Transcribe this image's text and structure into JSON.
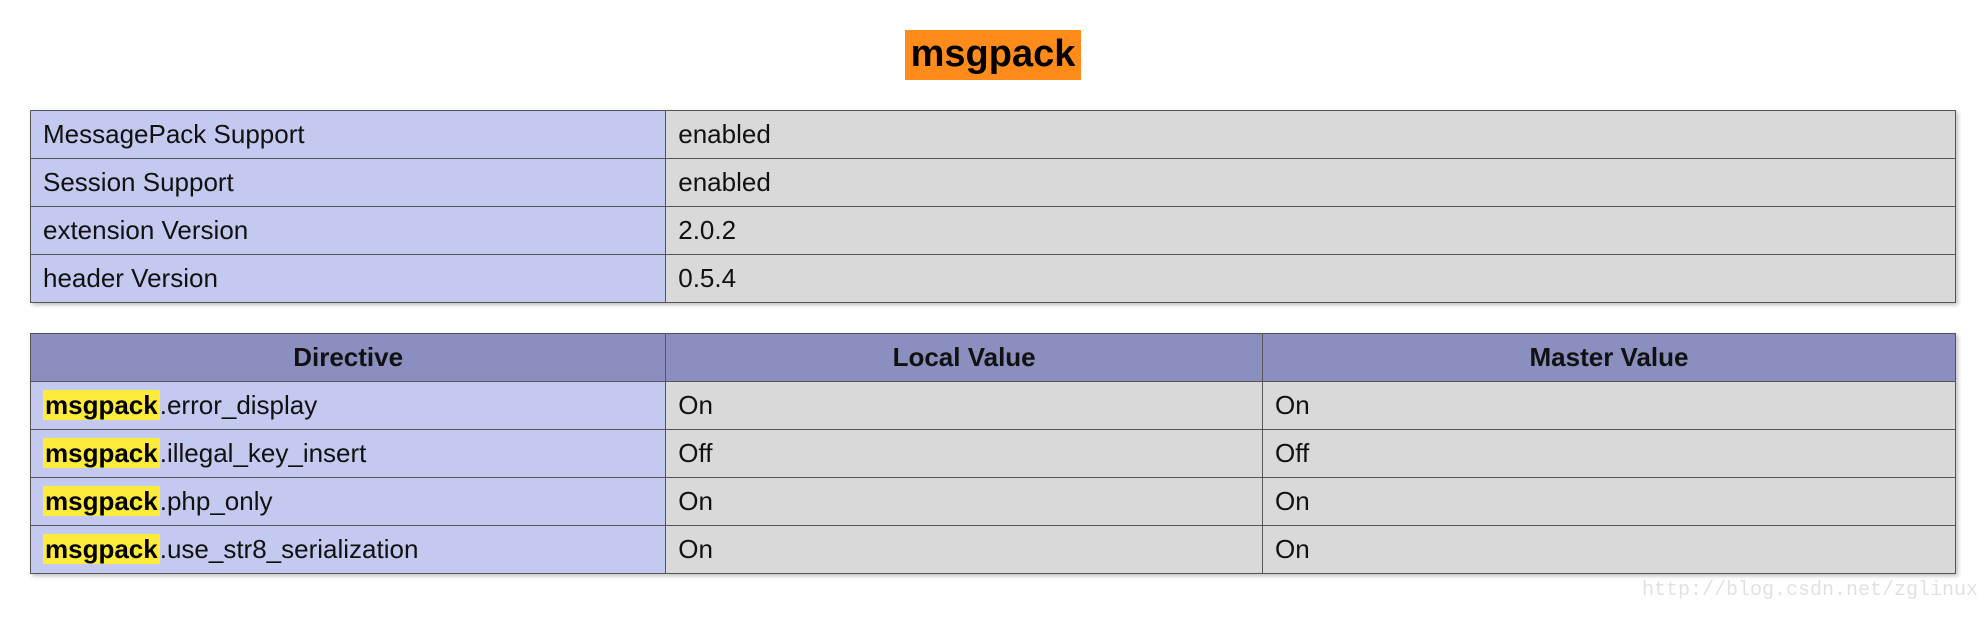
{
  "title": "msgpack",
  "highlight_term": "msgpack",
  "info_table": [
    {
      "label": "MessagePack Support",
      "value": "enabled"
    },
    {
      "label": "Session Support",
      "value": "enabled"
    },
    {
      "label": "extension Version",
      "value": "2.0.2"
    },
    {
      "label": "header Version",
      "value": "0.5.4"
    }
  ],
  "directives_table": {
    "headers": {
      "directive": "Directive",
      "local": "Local Value",
      "master": "Master Value"
    },
    "rows": [
      {
        "suffix": ".error_display",
        "local": "On",
        "master": "On"
      },
      {
        "suffix": ".illegal_key_insert",
        "local": "Off",
        "master": "Off"
      },
      {
        "suffix": ".php_only",
        "local": "On",
        "master": "On"
      },
      {
        "suffix": ".use_str8_serialization",
        "local": "On",
        "master": "On"
      }
    ]
  },
  "watermark": "http://blog.csdn.net/zglinux"
}
